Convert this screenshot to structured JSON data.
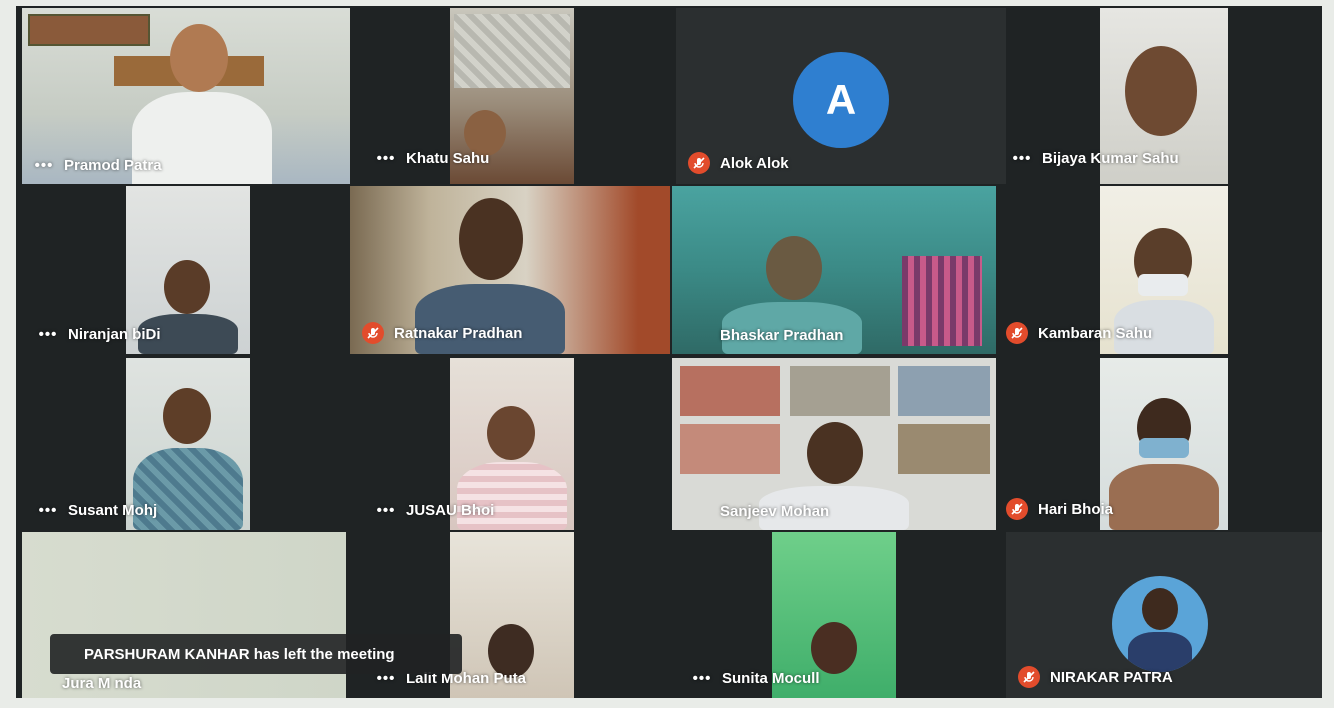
{
  "toast": {
    "message": "PARSHURAM KANHAR has left the meeting"
  },
  "avatar_letter": "A",
  "participants": [
    {
      "name": "Pramod Patra",
      "indicator": "more-options"
    },
    {
      "name": "Khatu Sahu",
      "indicator": "more-options"
    },
    {
      "name": "Alok Alok",
      "indicator": "muted"
    },
    {
      "name": "Bijaya Kumar Sahu",
      "indicator": "more-options"
    },
    {
      "name": "Niranjan biDi",
      "indicator": "more-options"
    },
    {
      "name": "Ratnakar Pradhan",
      "indicator": "muted"
    },
    {
      "name": "Bhaskar Pradhan",
      "indicator": "none"
    },
    {
      "name": "Kambaran Sahu",
      "indicator": "muted"
    },
    {
      "name": "Susant Mohj",
      "indicator": "more-options"
    },
    {
      "name": "JUSAU Bhoi",
      "indicator": "more-options"
    },
    {
      "name": "Sanjeev Mohan",
      "indicator": "none"
    },
    {
      "name": "Hari Bhoia",
      "indicator": "muted"
    },
    {
      "name": "Jura M nda",
      "indicator": "none"
    },
    {
      "name": "Lalit Mohan Puta",
      "indicator": "more-options"
    },
    {
      "name": "Sunita Mocull",
      "indicator": "more-options"
    },
    {
      "name": "NIRAKAR PATRA",
      "indicator": "muted"
    }
  ],
  "colors": {
    "mute_badge": "#e24c2c",
    "avatar_letter_bg": "#2f7fd0",
    "screen_bg": "#1f2324"
  }
}
